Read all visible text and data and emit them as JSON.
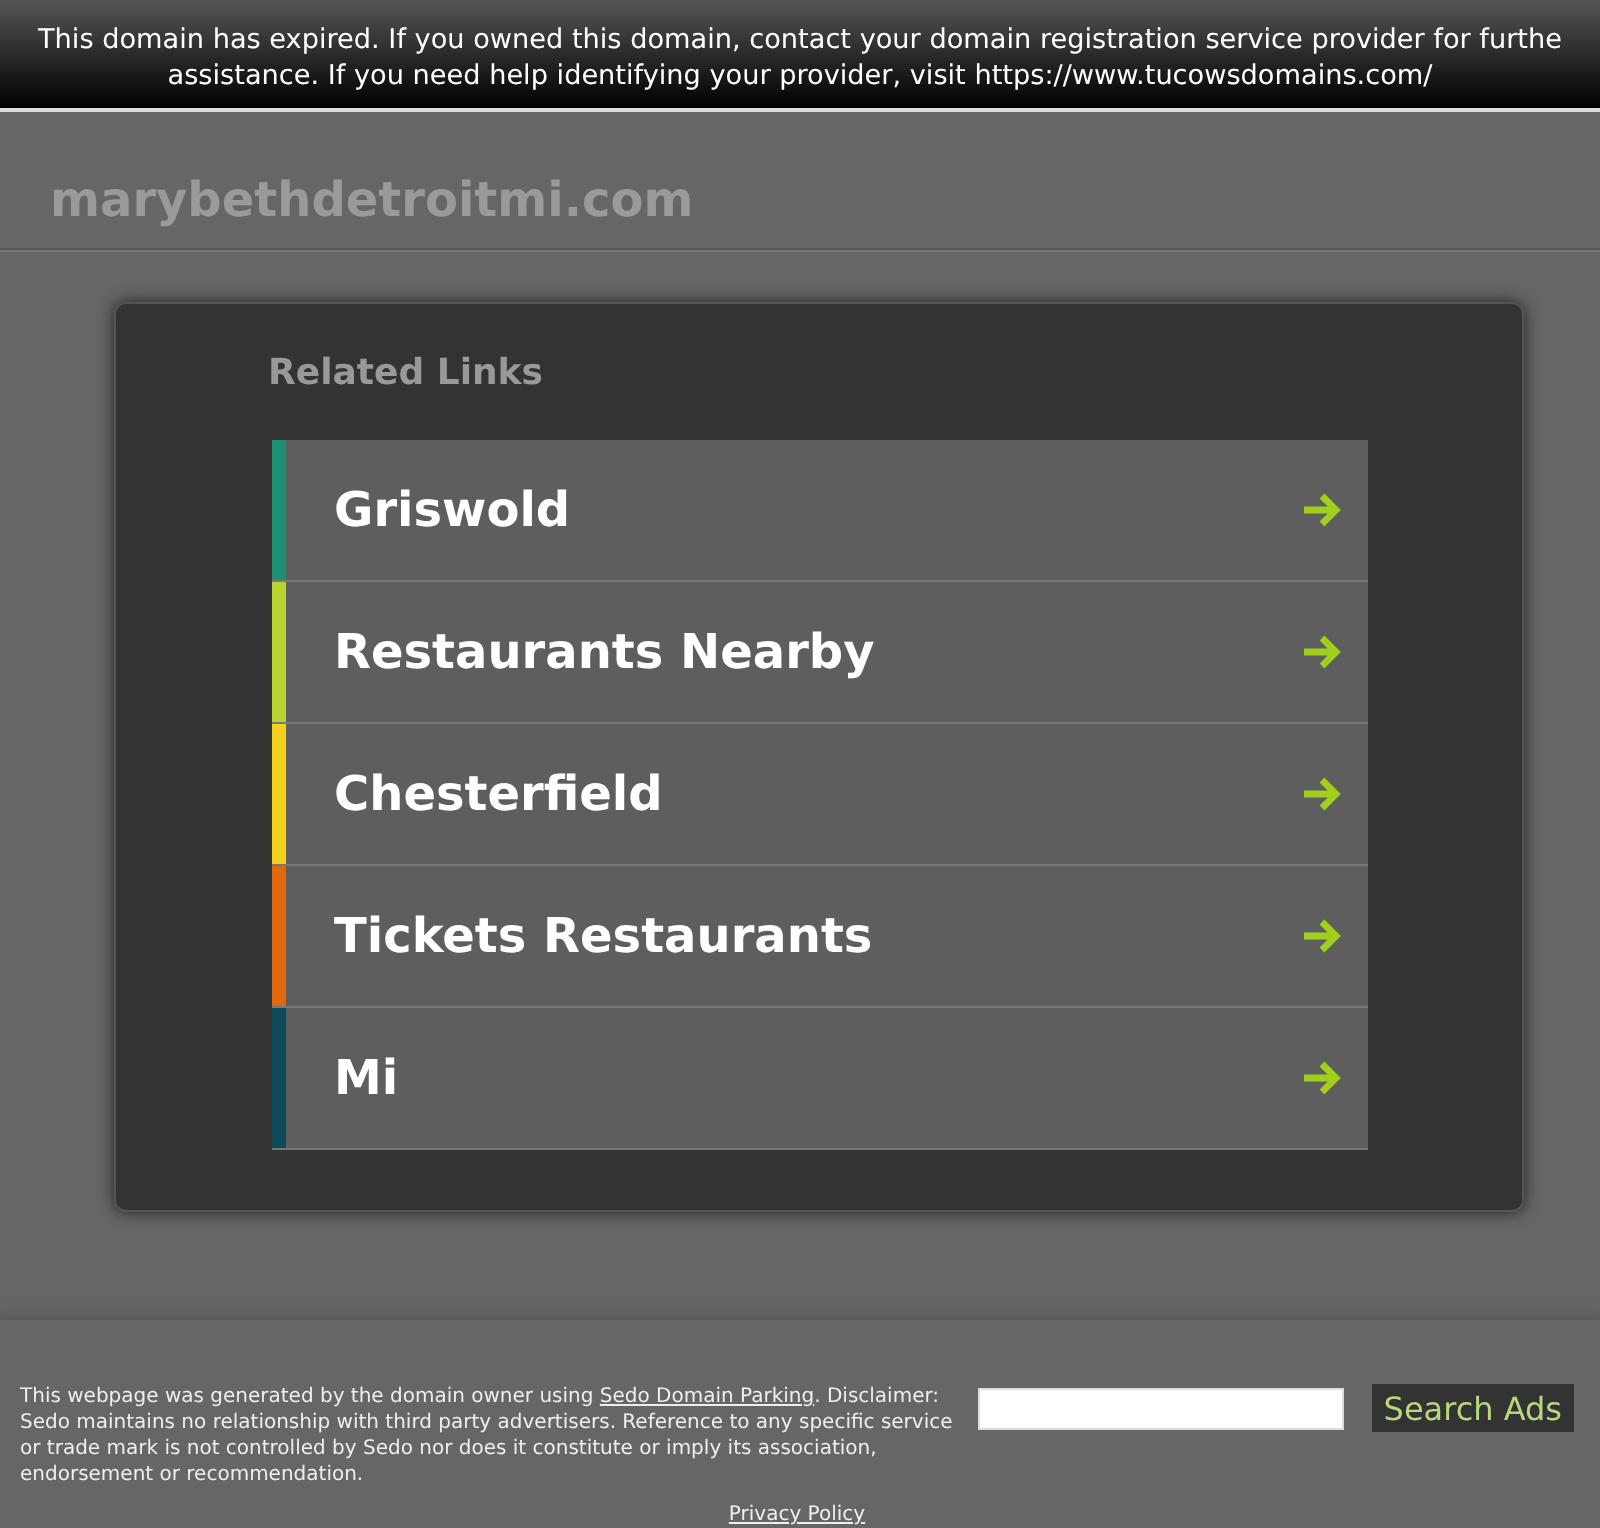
{
  "banner": {
    "lines": [
      "This domain has expired. If you owned this domain, contact your domain registration service provider for furthe",
      "assistance. If you need help identifying your provider, visit https://www.tucowsdomains.com/"
    ]
  },
  "header": {
    "domain": "marybethdetroitmi.com"
  },
  "related": {
    "title": "Related Links",
    "links": [
      {
        "label": "Griswold",
        "color": "#1f8f73"
      },
      {
        "label": "Restaurants Nearby",
        "color": "#b8d432"
      },
      {
        "label": "Chesterfield",
        "color": "#f2d21c"
      },
      {
        "label": "Tickets Restaurants",
        "color": "#e2680e"
      },
      {
        "label": "Mi",
        "color": "#0c4a5c"
      }
    ]
  },
  "footer": {
    "disclaimer_before": "This webpage was generated by the domain owner using ",
    "disclaimer_link": "Sedo Domain Parking",
    "disclaimer_after": ". Disclaimer: Sedo maintains no relationship with third party advertisers. Reference to any specific service or trade mark is not controlled by Sedo nor does it constitute or imply its association, endorsement or recommendation.",
    "search_button": "Search Ads",
    "privacy": "Privacy Policy"
  }
}
